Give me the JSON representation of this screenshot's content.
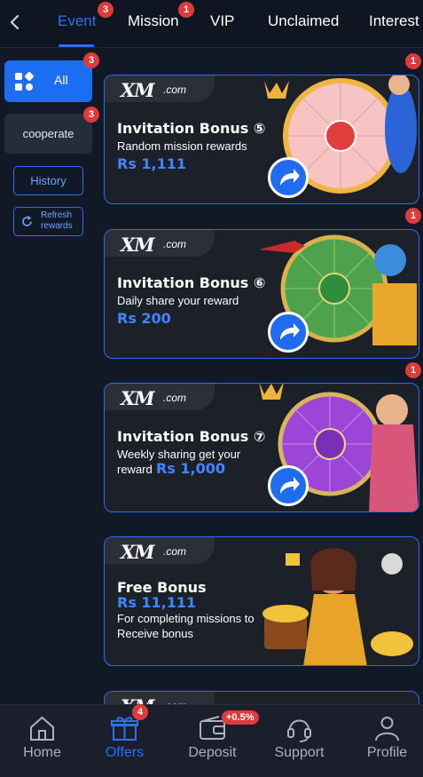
{
  "tabs": [
    {
      "label": "Event",
      "badge": "3",
      "active": true
    },
    {
      "label": "Mission",
      "badge": "1"
    },
    {
      "label": "VIP"
    },
    {
      "label": "Unclaimed"
    },
    {
      "label": "Interest"
    }
  ],
  "sidebar": {
    "all": {
      "label": "All",
      "badge": "3"
    },
    "cooperate": {
      "label": "cooperate",
      "badge": "3"
    },
    "history": "History",
    "refresh": "Refresh rewards"
  },
  "brand": {
    "logo": "XM",
    "domain": ".com"
  },
  "cards": [
    {
      "title": "Invitation Bonus ⑤",
      "sub": "Random mission rewards",
      "amount": "Rs 1,111",
      "badge": "1"
    },
    {
      "title": "Invitation Bonus ⑥",
      "sub": "Daily share your reward",
      "amount": "Rs 200",
      "badge": "1"
    },
    {
      "title": "Invitation Bonus ⑦",
      "sub_line1": "Weekly sharing get your",
      "sub_line2_prefix": "reward",
      "amount": "Rs 1,000",
      "badge": "1"
    },
    {
      "title": "Free Bonus",
      "amount": "Rs 11,111",
      "sub_line1": "For completing missions to",
      "sub_line2": "Receive bonus"
    }
  ],
  "nav": [
    {
      "label": "Home"
    },
    {
      "label": "Offers",
      "badge": "4",
      "active": true
    },
    {
      "label": "Deposit",
      "badge": "+0.5%"
    },
    {
      "label": "Support"
    },
    {
      "label": "Profile"
    }
  ],
  "colors": {
    "accent": "#2f6ff2",
    "badge": "#e03a3a",
    "background": "#111826"
  }
}
